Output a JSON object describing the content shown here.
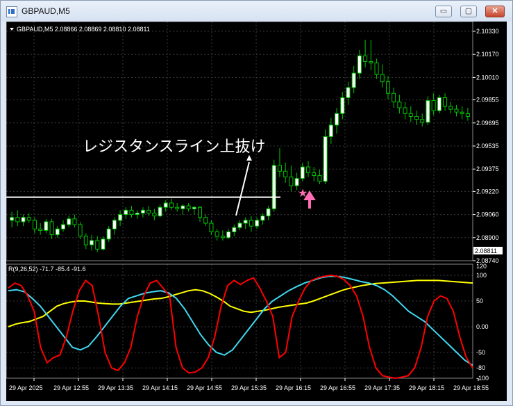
{
  "window": {
    "title": "GBPAUD,M5",
    "buttons": {
      "minimize": "▭",
      "maximize": "▢",
      "close": "✕"
    }
  },
  "colors": {
    "background": "#000000",
    "grid": "#3a3a3a",
    "bull_candle": "#ffffff",
    "bear_candle": "#ffffff",
    "candle_outline": "#00c800",
    "hline": "#ffffff",
    "rci_short": "#ff0000",
    "rci_mid": "#40d8f0",
    "rci_long": "#ffff00",
    "star": "#ff6eb4",
    "arrow": "#ff6eb4"
  },
  "price_panel": {
    "header": "GBPAUD,M5  2.08866 2.08869 2.08810 2.08811",
    "current_price": "2.08811",
    "annotation": "レジスタンスライン上抜け",
    "horizontal_line_price": 2.0918,
    "y_labels": [
      "2.10330",
      "2.10170",
      "2.10010",
      "2.09855",
      "2.09695",
      "2.09535",
      "2.09375",
      "2.09220",
      "2.09060",
      "2.08900",
      "2.08740"
    ]
  },
  "indicator_panel": {
    "header": "R(9,26,52) -71.7 -85.4 -91.6",
    "y_labels": [
      "120",
      "100",
      "50",
      "0.00",
      "-50",
      "-80",
      "-100"
    ]
  },
  "x_labels": [
    "29 Apr 2025",
    "29 Apr 12:55",
    "29 Apr 13:35",
    "29 Apr 14:15",
    "29 Apr 14:55",
    "29 Apr 15:35",
    "29 Apr 16:15",
    "29 Apr 16:55",
    "29 Apr 17:35",
    "29 Apr 18:15",
    "29 Apr 18:55"
  ],
  "chart_data": {
    "type": "candlestick",
    "price_axis_range": [
      2.0874,
      2.1033
    ],
    "candles": [
      {
        "o": 2.0902,
        "h": 2.0908,
        "l": 2.0897,
        "c": 2.0904
      },
      {
        "o": 2.0904,
        "h": 2.0909,
        "l": 2.0898,
        "c": 2.0901
      },
      {
        "o": 2.0901,
        "h": 2.0906,
        "l": 2.0898,
        "c": 2.0904
      },
      {
        "o": 2.0904,
        "h": 2.0907,
        "l": 2.09,
        "c": 2.0902
      },
      {
        "o": 2.0902,
        "h": 2.0904,
        "l": 2.0893,
        "c": 2.0896
      },
      {
        "o": 2.0896,
        "h": 2.09,
        "l": 2.0892,
        "c": 2.0895
      },
      {
        "o": 2.0895,
        "h": 2.0903,
        "l": 2.0893,
        "c": 2.0901
      },
      {
        "o": 2.0901,
        "h": 2.0903,
        "l": 2.0889,
        "c": 2.0892
      },
      {
        "o": 2.0892,
        "h": 2.0898,
        "l": 2.089,
        "c": 2.0896
      },
      {
        "o": 2.0896,
        "h": 2.0902,
        "l": 2.0894,
        "c": 2.0899
      },
      {
        "o": 2.0899,
        "h": 2.0905,
        "l": 2.0897,
        "c": 2.0903
      },
      {
        "o": 2.0903,
        "h": 2.0906,
        "l": 2.0897,
        "c": 2.0899
      },
      {
        "o": 2.0899,
        "h": 2.0901,
        "l": 2.0889,
        "c": 2.0891
      },
      {
        "o": 2.0891,
        "h": 2.0893,
        "l": 2.0882,
        "c": 2.0885
      },
      {
        "o": 2.0885,
        "h": 2.0892,
        "l": 2.0881,
        "c": 2.0888
      },
      {
        "o": 2.0888,
        "h": 2.0891,
        "l": 2.088,
        "c": 2.0882
      },
      {
        "o": 2.0882,
        "h": 2.0891,
        "l": 2.0881,
        "c": 2.0889
      },
      {
        "o": 2.0889,
        "h": 2.0898,
        "l": 2.0887,
        "c": 2.0896
      },
      {
        "o": 2.0896,
        "h": 2.0904,
        "l": 2.0892,
        "c": 2.0902
      },
      {
        "o": 2.0902,
        "h": 2.0909,
        "l": 2.0898,
        "c": 2.0906
      },
      {
        "o": 2.0906,
        "h": 2.0911,
        "l": 2.0903,
        "c": 2.0909
      },
      {
        "o": 2.0909,
        "h": 2.0912,
        "l": 2.0904,
        "c": 2.0906
      },
      {
        "o": 2.0906,
        "h": 2.0909,
        "l": 2.0903,
        "c": 2.0907
      },
      {
        "o": 2.0907,
        "h": 2.0911,
        "l": 2.0904,
        "c": 2.0909
      },
      {
        "o": 2.0909,
        "h": 2.0912,
        "l": 2.0905,
        "c": 2.0907
      },
      {
        "o": 2.0907,
        "h": 2.091,
        "l": 2.0902,
        "c": 2.0905
      },
      {
        "o": 2.0905,
        "h": 2.0913,
        "l": 2.0904,
        "c": 2.0911
      },
      {
        "o": 2.0911,
        "h": 2.0916,
        "l": 2.0908,
        "c": 2.0914
      },
      {
        "o": 2.0914,
        "h": 2.0917,
        "l": 2.0909,
        "c": 2.0911
      },
      {
        "o": 2.0911,
        "h": 2.0914,
        "l": 2.0908,
        "c": 2.091
      },
      {
        "o": 2.091,
        "h": 2.0913,
        "l": 2.0906,
        "c": 2.0912
      },
      {
        "o": 2.0912,
        "h": 2.0914,
        "l": 2.0908,
        "c": 2.091
      },
      {
        "o": 2.091,
        "h": 2.0912,
        "l": 2.0906,
        "c": 2.0911
      },
      {
        "o": 2.0911,
        "h": 2.0912,
        "l": 2.0901,
        "c": 2.0904
      },
      {
        "o": 2.0904,
        "h": 2.0906,
        "l": 2.0898,
        "c": 2.09
      },
      {
        "o": 2.09,
        "h": 2.0902,
        "l": 2.0892,
        "c": 2.0894
      },
      {
        "o": 2.0894,
        "h": 2.0896,
        "l": 2.0888,
        "c": 2.0891
      },
      {
        "o": 2.0891,
        "h": 2.0895,
        "l": 2.0888,
        "c": 2.089
      },
      {
        "o": 2.089,
        "h": 2.0896,
        "l": 2.0889,
        "c": 2.0894
      },
      {
        "o": 2.0894,
        "h": 2.0899,
        "l": 2.0891,
        "c": 2.0897
      },
      {
        "o": 2.0897,
        "h": 2.0902,
        "l": 2.0895,
        "c": 2.09
      },
      {
        "o": 2.09,
        "h": 2.0904,
        "l": 2.0896,
        "c": 2.0902
      },
      {
        "o": 2.0902,
        "h": 2.0905,
        "l": 2.0894,
        "c": 2.0898
      },
      {
        "o": 2.0898,
        "h": 2.0904,
        "l": 2.0896,
        "c": 2.0902
      },
      {
        "o": 2.0902,
        "h": 2.0907,
        "l": 2.0899,
        "c": 2.0905
      },
      {
        "o": 2.0905,
        "h": 2.0912,
        "l": 2.0902,
        "c": 2.091
      },
      {
        "o": 2.091,
        "h": 2.0944,
        "l": 2.0908,
        "c": 2.094
      },
      {
        "o": 2.094,
        "h": 2.0952,
        "l": 2.0932,
        "c": 2.0936
      },
      {
        "o": 2.0936,
        "h": 2.0942,
        "l": 2.0928,
        "c": 2.0932
      },
      {
        "o": 2.0932,
        "h": 2.094,
        "l": 2.0922,
        "c": 2.0926
      },
      {
        "o": 2.0926,
        "h": 2.0935,
        "l": 2.0923,
        "c": 2.0931
      },
      {
        "o": 2.0931,
        "h": 2.0942,
        "l": 2.0929,
        "c": 2.0939
      },
      {
        "o": 2.0939,
        "h": 2.0943,
        "l": 2.0932,
        "c": 2.0935
      },
      {
        "o": 2.0935,
        "h": 2.0939,
        "l": 2.0929,
        "c": 2.0933
      },
      {
        "o": 2.0933,
        "h": 2.0937,
        "l": 2.0927,
        "c": 2.0929
      },
      {
        "o": 2.0929,
        "h": 2.0965,
        "l": 2.0927,
        "c": 2.096
      },
      {
        "o": 2.096,
        "h": 2.0973,
        "l": 2.0955,
        "c": 2.0968
      },
      {
        "o": 2.0968,
        "h": 2.098,
        "l": 2.0962,
        "c": 2.0976
      },
      {
        "o": 2.0976,
        "h": 2.0991,
        "l": 2.0972,
        "c": 2.0987
      },
      {
        "o": 2.0987,
        "h": 2.0998,
        "l": 2.0982,
        "c": 2.0994
      },
      {
        "o": 2.0994,
        "h": 2.1009,
        "l": 2.099,
        "c": 2.1004
      },
      {
        "o": 2.1004,
        "h": 2.102,
        "l": 2.1,
        "c": 2.1016
      },
      {
        "o": 2.1016,
        "h": 2.1027,
        "l": 2.1008,
        "c": 2.1012
      },
      {
        "o": 2.1012,
        "h": 2.1027,
        "l": 2.1006,
        "c": 2.1011
      },
      {
        "o": 2.1011,
        "h": 2.1014,
        "l": 2.1,
        "c": 2.1003
      },
      {
        "o": 2.1003,
        "h": 2.101,
        "l": 2.0994,
        "c": 2.0998
      },
      {
        "o": 2.0998,
        "h": 2.1002,
        "l": 2.0986,
        "c": 2.099
      },
      {
        "o": 2.099,
        "h": 2.0994,
        "l": 2.098,
        "c": 2.0984
      },
      {
        "o": 2.0984,
        "h": 2.0989,
        "l": 2.0976,
        "c": 2.098
      },
      {
        "o": 2.098,
        "h": 2.0984,
        "l": 2.0972,
        "c": 2.0976
      },
      {
        "o": 2.0976,
        "h": 2.0981,
        "l": 2.097,
        "c": 2.0974
      },
      {
        "o": 2.0974,
        "h": 2.0978,
        "l": 2.0968,
        "c": 2.0972
      },
      {
        "o": 2.0972,
        "h": 2.0976,
        "l": 2.0967,
        "c": 2.097
      },
      {
        "o": 2.097,
        "h": 2.0988,
        "l": 2.0968,
        "c": 2.0985
      },
      {
        "o": 2.0985,
        "h": 2.099,
        "l": 2.0975,
        "c": 2.0978
      },
      {
        "o": 2.0978,
        "h": 2.0989,
        "l": 2.0976,
        "c": 2.0987
      },
      {
        "o": 2.0987,
        "h": 2.099,
        "l": 2.0978,
        "c": 2.0981
      },
      {
        "o": 2.0981,
        "h": 2.0984,
        "l": 2.0976,
        "c": 2.0979
      },
      {
        "o": 2.0979,
        "h": 2.0982,
        "l": 2.0974,
        "c": 2.0977
      },
      {
        "o": 2.0977,
        "h": 2.0981,
        "l": 2.0972,
        "c": 2.0976
      },
      {
        "o": 2.0976,
        "h": 2.098,
        "l": 2.0971,
        "c": 2.0974
      }
    ],
    "rci_short": [
      75,
      85,
      80,
      60,
      30,
      -40,
      -70,
      -60,
      -55,
      -20,
      30,
      70,
      90,
      80,
      20,
      -50,
      -80,
      -85,
      -70,
      -40,
      20,
      60,
      85,
      90,
      75,
      60,
      -40,
      -80,
      -90,
      -88,
      -80,
      -60,
      -20,
      40,
      80,
      90,
      82,
      90,
      95,
      75,
      50,
      20,
      -60,
      -50,
      20,
      50,
      75,
      90,
      95,
      98,
      100,
      98,
      92,
      80,
      60,
      20,
      -40,
      -80,
      -95,
      -98,
      -100,
      -98,
      -95,
      -80,
      -40,
      20,
      50,
      60,
      55,
      30,
      -20,
      -60,
      -80
    ],
    "rci_mid": [
      70,
      72,
      68,
      55,
      40,
      20,
      0,
      -20,
      -40,
      -45,
      -38,
      -20,
      0,
      20,
      40,
      55,
      60,
      65,
      68,
      70,
      66,
      55,
      35,
      10,
      -15,
      -35,
      -50,
      -55,
      -45,
      -25,
      -5,
      15,
      35,
      50,
      60,
      70,
      78,
      85,
      90,
      95,
      98,
      98,
      96,
      92,
      88,
      85,
      80,
      72,
      60,
      45,
      30,
      20,
      10,
      -5,
      -20,
      -35,
      -50,
      -65,
      -75
    ],
    "rci_long": [
      0,
      5,
      8,
      10,
      15,
      20,
      30,
      40,
      45,
      48,
      50,
      50,
      48,
      46,
      45,
      44,
      44,
      46,
      48,
      50,
      52,
      54,
      55,
      58,
      62,
      66,
      70,
      72,
      70,
      65,
      58,
      50,
      40,
      35,
      30,
      28,
      30,
      32,
      35,
      38,
      40,
      42,
      44,
      46,
      50,
      55,
      60,
      65,
      70,
      74,
      77,
      80,
      82,
      84,
      85,
      86,
      87,
      88,
      89,
      90,
      90,
      90,
      90,
      89,
      88,
      87,
      86,
      85
    ]
  }
}
